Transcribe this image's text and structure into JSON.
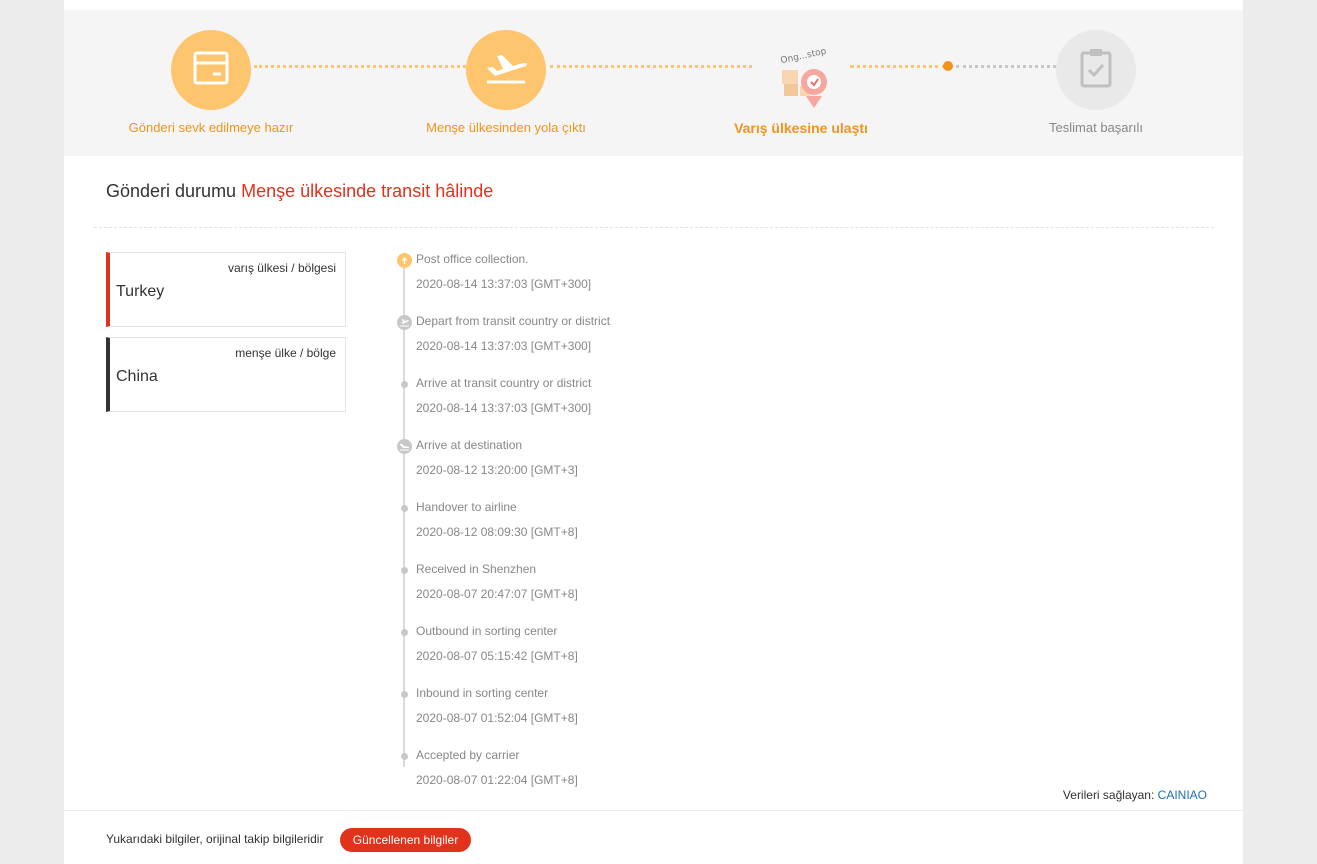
{
  "steps": [
    {
      "label": "Gönderi sevk edilmeye hazır",
      "icon": "package-icon",
      "state": "done"
    },
    {
      "label": "Menşe ülkesinden yola çıktı",
      "icon": "plane-takeoff-icon",
      "state": "done"
    },
    {
      "label": "Varış ülkesine ulaştı",
      "icon": "arrived-image",
      "state": "active"
    },
    {
      "label": "Teslimat başarılı",
      "icon": "clipboard-check-icon",
      "state": "todo"
    }
  ],
  "status": {
    "label": "Gönderi durumu",
    "value": "Menşe ülkesinde transit hâlinde"
  },
  "destination": {
    "label": "varış ülkesi / bölgesi",
    "name": "Turkey"
  },
  "origin": {
    "label": "menşe ülke / bölge",
    "name": "China"
  },
  "events": [
    {
      "text": "Post office collection.",
      "time": "2020-08-14 13:37:03 [GMT+300]",
      "icon": "arrow-up-icon"
    },
    {
      "text": "Depart from transit country or district",
      "time": "2020-08-14 13:37:03 [GMT+300]",
      "icon": "plane-takeoff-icon"
    },
    {
      "text": "Arrive at transit country or district",
      "time": "2020-08-14 13:37:03 [GMT+300]",
      "icon": "dot"
    },
    {
      "text": "Arrive at destination",
      "time": "2020-08-12 13:20:00 [GMT+3]",
      "icon": "plane-landing-icon"
    },
    {
      "text": "Handover to airline",
      "time": "2020-08-12 08:09:30 [GMT+8]",
      "icon": "dot"
    },
    {
      "text": "Received in Shenzhen",
      "time": "2020-08-07 20:47:07 [GMT+8]",
      "icon": "dot"
    },
    {
      "text": "Outbound in sorting center",
      "time": "2020-08-07 05:15:42 [GMT+8]",
      "icon": "dot"
    },
    {
      "text": "Inbound in sorting center",
      "time": "2020-08-07 01:52:04 [GMT+8]",
      "icon": "dot"
    },
    {
      "text": "Accepted by carrier",
      "time": "2020-08-07 01:22:04 [GMT+8]",
      "icon": "dot"
    }
  ],
  "provider": {
    "label": "Verileri sağlayan:",
    "name": "CAINIAO"
  },
  "footer": {
    "text": "Yukarıdaki bilgiler, orijinal takip bilgileridir",
    "button": "Güncellenen bilgiler"
  },
  "colors": {
    "accent": "#f0941e",
    "step_done": "#fdc56d",
    "status_red": "#e1321c",
    "link": "#1f6fb8"
  }
}
